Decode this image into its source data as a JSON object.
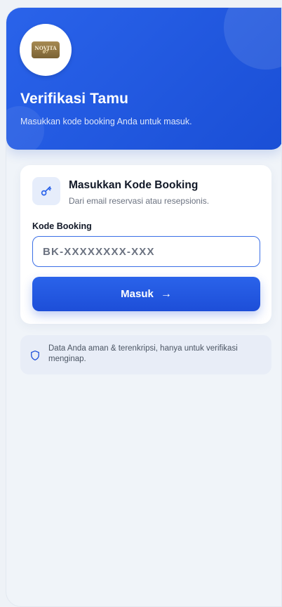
{
  "header": {
    "logo_text": "NOVITA",
    "logo_number": "07",
    "title": "Verifikasi Tamu",
    "subtitle": "Masukkan kode booking Anda untuk masuk."
  },
  "card": {
    "icon": "key-icon",
    "title": "Masukkan Kode Booking",
    "subtitle": "Dari email reservasi atau resepsionis.",
    "field_label": "Kode Booking",
    "input_placeholder": "BK-XXXXXXXX-XXX",
    "input_value": "",
    "submit_label": "Masuk",
    "submit_icon": "arrow-right-icon"
  },
  "notice": {
    "icon": "shield-icon",
    "text": "Data Anda aman & terenkripsi, hanya untuk verifikasi menginap."
  },
  "colors": {
    "primary": "#1d4ed8",
    "header_gradient_start": "#2a63ea",
    "background": "#f0f4f9",
    "card": "#ffffff",
    "notice_bg": "#e8edf7"
  }
}
